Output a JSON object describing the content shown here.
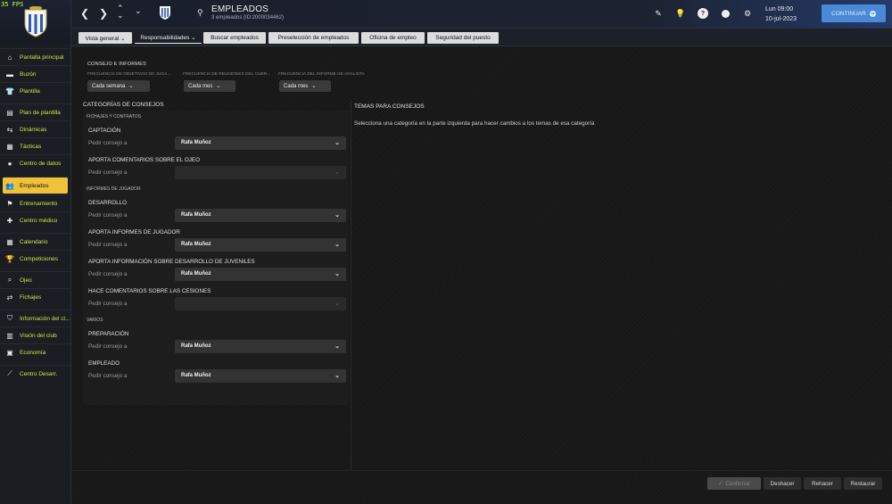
{
  "fps": "35 FPS",
  "sidebar": {
    "items": [
      {
        "label": "Pantalla principal",
        "icon": "home-icon",
        "glyph": "⌂"
      },
      {
        "label": "Buzón",
        "icon": "inbox-icon",
        "glyph": "▬"
      },
      {
        "label": "Plantilla",
        "icon": "shirt-icon",
        "glyph": "👕"
      },
      {
        "label": "Plan de plantilla",
        "icon": "clipboard-icon",
        "glyph": "▤"
      },
      {
        "label": "Dinámicas",
        "icon": "dynamics-icon",
        "glyph": "⇆"
      },
      {
        "label": "Tácticas",
        "icon": "tactics-icon",
        "glyph": "▦"
      },
      {
        "label": "Centro de datos",
        "icon": "data-icon",
        "glyph": "●"
      },
      {
        "label": "Empleados",
        "icon": "staff-icon",
        "glyph": "👥"
      },
      {
        "label": "Entrenamiento",
        "icon": "training-icon",
        "glyph": "⚑"
      },
      {
        "label": "Centro médico",
        "icon": "medical-icon",
        "glyph": "✚"
      },
      {
        "label": "Calendario",
        "icon": "calendar-icon",
        "glyph": "▦"
      },
      {
        "label": "Competiciones",
        "icon": "trophy-icon",
        "glyph": "🏆"
      },
      {
        "label": "Ojeo",
        "icon": "scouting-icon",
        "glyph": "⌕"
      },
      {
        "label": "Fichajes",
        "icon": "transfers-icon",
        "glyph": "⇄"
      },
      {
        "label": "Información del cl...",
        "icon": "club-info-icon",
        "glyph": "⛉"
      },
      {
        "label": "Visión del club",
        "icon": "club-vision-icon",
        "glyph": "▥"
      },
      {
        "label": "Economía",
        "icon": "finances-icon",
        "glyph": "▣"
      },
      {
        "label": "Centro Desarr.",
        "icon": "development-icon",
        "glyph": "⟋"
      }
    ]
  },
  "header": {
    "title": "EMPLEADOS",
    "subtitle": "3 empleados (ID:2000034462)",
    "time": "Lun 09:00",
    "date": "10-jul-2023",
    "continue_label": "CONTINUAR"
  },
  "tabs": [
    {
      "label": "Vista general ⌄",
      "name": "tab-vista-general"
    },
    {
      "label": "Responsabilidades ⌄",
      "name": "tab-responsabilidades"
    },
    {
      "label": "Buscar empleados",
      "name": "tab-buscar-empleados"
    },
    {
      "label": "Preselección de empleados",
      "name": "tab-preseleccion"
    },
    {
      "label": "Oficina de empleo",
      "name": "tab-oficina-empleo"
    },
    {
      "label": "Seguridad del puesto",
      "name": "tab-seguridad-puesto"
    }
  ],
  "settings": {
    "section_label": "CONSEJO E INFORMES",
    "frequencies": [
      {
        "label": "FRECUENCIA DE OBJETIVOS DE JUGA...",
        "value": "Cada semana"
      },
      {
        "label": "FRECUENCIA DE REUNIONES DEL CUER...",
        "value": "Cada mes"
      },
      {
        "label": "FRECUENCIA DEL INFORME DE ANALISTA",
        "value": "Cada mes"
      }
    ]
  },
  "categories": {
    "title": "CATEGORÍAS DE CONSEJOS",
    "ask_label": "Pedir consejo a",
    "groups": [
      {
        "name": "FICHAJES Y CONTRATOS",
        "items": [
          {
            "title": "CAPTACIÓN",
            "value": "Rafa Muñoz",
            "disabled": false
          },
          {
            "title": "APORTA COMENTARIOS SOBRE EL OJEO",
            "value": "",
            "disabled": true
          }
        ]
      },
      {
        "name": "INFORMES DE JUGADOR",
        "items": [
          {
            "title": "DESARROLLO",
            "value": "Rafa Muñoz",
            "disabled": false
          },
          {
            "title": "APORTA INFORMES DE JUGADOR",
            "value": "Rafa Muñoz",
            "disabled": false
          },
          {
            "title": "APORTA INFORMACIÓN SOBRE DESARROLLO DE JUVENILES",
            "value": "Rafa Muñoz",
            "disabled": false
          },
          {
            "title": "HACE COMENTARIOS SOBRE LAS CESIONES",
            "value": "",
            "disabled": true
          }
        ]
      },
      {
        "name": "VARIOS",
        "items": [
          {
            "title": "PREPARACIÓN",
            "value": "Rafa Muñoz",
            "disabled": false
          },
          {
            "title": "EMPLEADO",
            "value": "Rafa Muñoz",
            "disabled": false
          }
        ]
      }
    ]
  },
  "right_panel": {
    "title": "TEMAS PARA CONSEJOS",
    "text": "Selecciona una categoría en la parte izquierda para hacer cambios a los temas de esa categoría"
  },
  "footer": {
    "confirm": "Confirmar",
    "undo": "Deshacer",
    "redo": "Rehacer",
    "restore": "Restaurar"
  }
}
